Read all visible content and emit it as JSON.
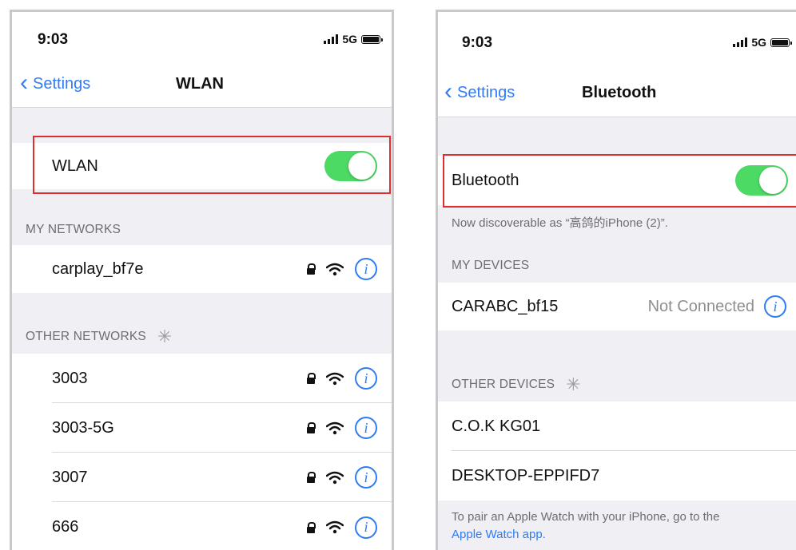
{
  "wlan_screen": {
    "time": "9:03",
    "network": "5G",
    "back_label": "Settings",
    "title": "WLAN",
    "toggle_label": "WLAN",
    "toggle_on": true,
    "my_networks_header": "MY NETWORKS",
    "my_networks": [
      {
        "name": "carplay_bf7e"
      }
    ],
    "other_networks_header": "OTHER NETWORKS",
    "other_networks": [
      {
        "name": "3003"
      },
      {
        "name": "3003-5G"
      },
      {
        "name": "3007"
      },
      {
        "name": "666"
      }
    ]
  },
  "bluetooth_screen": {
    "time": "9:03",
    "network": "5G",
    "back_label": "Settings",
    "title": "Bluetooth",
    "toggle_label": "Bluetooth",
    "toggle_on": true,
    "discoverable_text": "Now discoverable as “高鸽的iPhone (2)”.",
    "my_devices_header": "MY DEVICES",
    "my_devices": [
      {
        "name": "CARABC_bf15",
        "status": "Not Connected"
      }
    ],
    "other_devices_header": "OTHER DEVICES",
    "other_devices": [
      {
        "name": "C.O.K KG01"
      },
      {
        "name": "DESKTOP-EPPIFD7"
      }
    ],
    "footer_text": "To pair an Apple Watch with your iPhone, go to the",
    "footer_link": "Apple Watch app."
  },
  "colors": {
    "accent_blue": "#2f7cf6",
    "toggle_green": "#4cd964",
    "highlight_red": "#e02d2d",
    "background": "#efeff4"
  },
  "icons": [
    "chevron-left-icon",
    "lock-icon",
    "wifi-icon",
    "info-icon",
    "spinner-icon",
    "signal-icon",
    "battery-icon"
  ]
}
